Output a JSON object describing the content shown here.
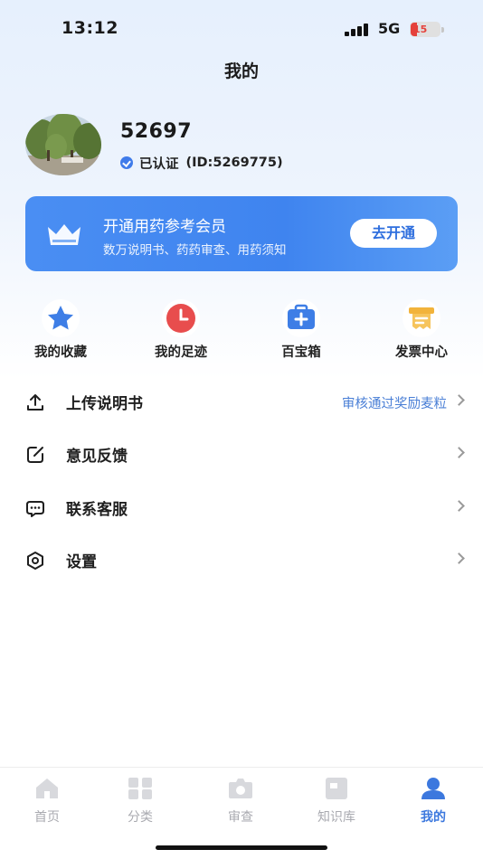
{
  "status_bar": {
    "time": "13:12",
    "network": "5G",
    "battery_level": "15"
  },
  "header": {
    "title": "我的"
  },
  "profile": {
    "username": "52697",
    "verified_label": "已认证",
    "user_id_text": "(ID:5269775)"
  },
  "member_banner": {
    "title": "开通用药参考会员",
    "subtitle": "数万说明书、药药审查、用药须知",
    "button_label": "去开通"
  },
  "quick_actions": [
    {
      "label": "我的收藏",
      "icon": "star-icon",
      "color": "#3e7ee6"
    },
    {
      "label": "我的足迹",
      "icon": "clock-icon",
      "color": "#e84d4d"
    },
    {
      "label": "百宝箱",
      "icon": "toolbox-icon",
      "color": "#3e7ee6"
    },
    {
      "label": "发票中心",
      "icon": "invoice-icon",
      "color": "#f2b33b"
    }
  ],
  "menu": [
    {
      "label": "上传说明书",
      "hint": "审核通过奖励麦粒",
      "icon": "upload-icon"
    },
    {
      "label": "意见反馈",
      "hint": "",
      "icon": "edit-icon"
    },
    {
      "label": "联系客服",
      "hint": "",
      "icon": "chat-icon"
    },
    {
      "label": "设置",
      "hint": "",
      "icon": "settings-icon"
    }
  ],
  "tab_bar": {
    "tabs": [
      {
        "label": "首页",
        "icon": "home-icon",
        "active": false
      },
      {
        "label": "分类",
        "icon": "grid-icon",
        "active": false
      },
      {
        "label": "审查",
        "icon": "camera-icon",
        "active": false
      },
      {
        "label": "知识库",
        "icon": "book-icon",
        "active": false
      },
      {
        "label": "我的",
        "icon": "person-icon",
        "active": true
      }
    ]
  },
  "colors": {
    "accent": "#3c78de",
    "banner": "#4a8ef3",
    "inactive_tab": "#a9aab0"
  }
}
